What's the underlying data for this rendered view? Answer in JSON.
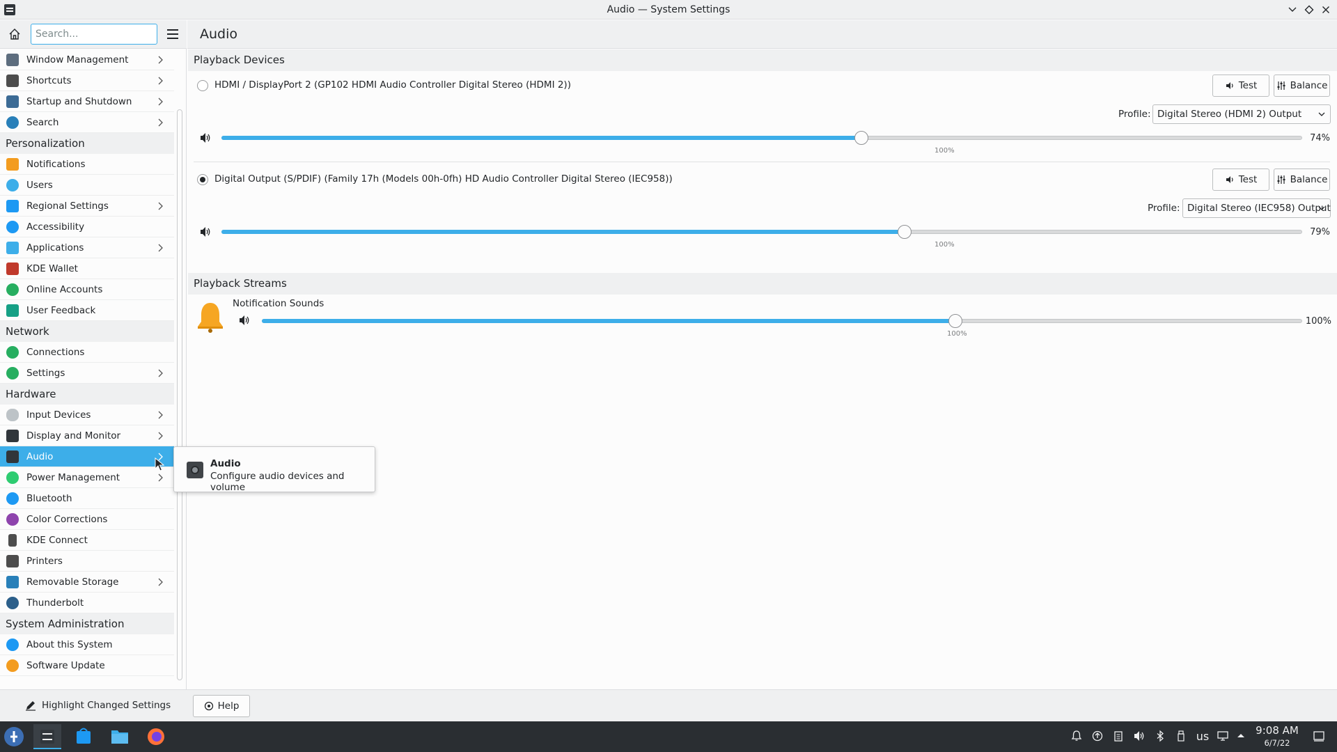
{
  "window": {
    "title": "Audio — System Settings"
  },
  "sidebar": {
    "search_placeholder": "Search...",
    "items": [
      {
        "label": "Window Management",
        "icon": "window-icon",
        "color": "#5d6d7e",
        "chevron": true
      },
      {
        "label": "Shortcuts",
        "icon": "keyboard-icon",
        "color": "#4d4d4d",
        "chevron": true
      },
      {
        "label": "Startup and Shutdown",
        "icon": "startup-icon",
        "color": "#3c6b95",
        "chevron": true
      },
      {
        "label": "Search",
        "icon": "search-icon",
        "color": "#2980b9",
        "chevron": true
      }
    ],
    "categories": {
      "personalization": "Personalization",
      "network": "Network",
      "hardware": "Hardware",
      "sysadmin": "System Administration"
    },
    "personalization": [
      {
        "label": "Notifications",
        "icon": "bell-icon",
        "color": "#f39c1f",
        "chevron": false
      },
      {
        "label": "Users",
        "icon": "users-icon",
        "color": "#3daee9",
        "chevron": false
      },
      {
        "label": "Regional Settings",
        "icon": "flag-icon",
        "color": "#1d99f3",
        "chevron": true
      },
      {
        "label": "Accessibility",
        "icon": "accessibility-icon",
        "color": "#1d99f3",
        "chevron": false
      },
      {
        "label": "Applications",
        "icon": "applications-icon",
        "color": "#3daee9",
        "chevron": true
      },
      {
        "label": "KDE Wallet",
        "icon": "wallet-icon",
        "color": "#c0392b",
        "chevron": false
      },
      {
        "label": "Online Accounts",
        "icon": "globe-icon",
        "color": "#27ae60",
        "chevron": false
      },
      {
        "label": "User Feedback",
        "icon": "feedback-icon",
        "color": "#16a085",
        "chevron": false
      }
    ],
    "network": [
      {
        "label": "Connections",
        "icon": "connections-icon",
        "color": "#27ae60",
        "chevron": false
      },
      {
        "label": "Settings",
        "icon": "network-settings-icon",
        "color": "#27ae60",
        "chevron": true
      }
    ],
    "hardware": [
      {
        "label": "Input Devices",
        "icon": "mouse-icon",
        "color": "#bdc3c7",
        "chevron": true
      },
      {
        "label": "Display and Monitor",
        "icon": "monitor-icon",
        "color": "#31363b",
        "chevron": true
      },
      {
        "label": "Audio",
        "icon": "speaker-icon",
        "color": "#31363b",
        "chevron": true,
        "selected": true
      },
      {
        "label": "Power Management",
        "icon": "power-icon",
        "color": "#2ecc71",
        "chevron": true
      },
      {
        "label": "Bluetooth",
        "icon": "bluetooth-icon",
        "color": "#1d99f3",
        "chevron": false
      },
      {
        "label": "Color Corrections",
        "icon": "color-icon",
        "color": "#8e44ad",
        "chevron": false
      },
      {
        "label": "KDE Connect",
        "icon": "phone-icon",
        "color": "#4d4d4d",
        "chevron": false
      },
      {
        "label": "Printers",
        "icon": "printer-icon",
        "color": "#4d4d4d",
        "chevron": false
      },
      {
        "label": "Removable Storage",
        "icon": "usb-icon",
        "color": "#2980b9",
        "chevron": true
      },
      {
        "label": "Thunderbolt",
        "icon": "thunderbolt-icon",
        "color": "#2c5f8a",
        "chevron": false
      }
    ],
    "sysadmin": [
      {
        "label": "About this System",
        "icon": "info-icon",
        "color": "#1d99f3",
        "chevron": false
      },
      {
        "label": "Software Update",
        "icon": "update-icon",
        "color": "#f39c1f",
        "chevron": false
      }
    ]
  },
  "main": {
    "page_title": "Audio",
    "playback_devices_title": "Playback Devices",
    "devices": [
      {
        "name": "HDMI / DisplayPort 2 (GP102 HDMI Audio Controller Digital Stereo (HDMI 2))",
        "selected": false,
        "test_label": "Test",
        "balance_label": "Balance",
        "profile_label": "Profile:",
        "profile_value": "Digital Stereo (HDMI 2) Output",
        "volume": 74,
        "volume_text": "74%",
        "mark_text": "100%"
      },
      {
        "name": "Digital Output (S/PDIF) (Family 17h (Models 00h-0fh) HD Audio Controller Digital Stereo (IEC958))",
        "selected": true,
        "test_label": "Test",
        "balance_label": "Balance",
        "profile_label": "Profile:",
        "profile_value": "Digital Stereo (IEC958) Output",
        "volume": 79,
        "volume_text": "79%",
        "mark_text": "100%"
      }
    ],
    "playback_streams_title": "Playback Streams",
    "streams": [
      {
        "name": "Notification Sounds",
        "volume": 100,
        "volume_text": "100%",
        "mark_text": "100%"
      }
    ]
  },
  "tooltip": {
    "title": "Audio",
    "description": "Configure audio devices and volume"
  },
  "footer": {
    "highlight_label": "Highlight Changed Settings",
    "help_label": "Help"
  },
  "taskbar": {
    "keyboard_layout": "us",
    "time": "9:08 AM",
    "date": "6/7/22"
  },
  "colors": {
    "accent": "#3daee9",
    "selected_text": "#ffffff",
    "taskbar": "#2a2e32"
  }
}
